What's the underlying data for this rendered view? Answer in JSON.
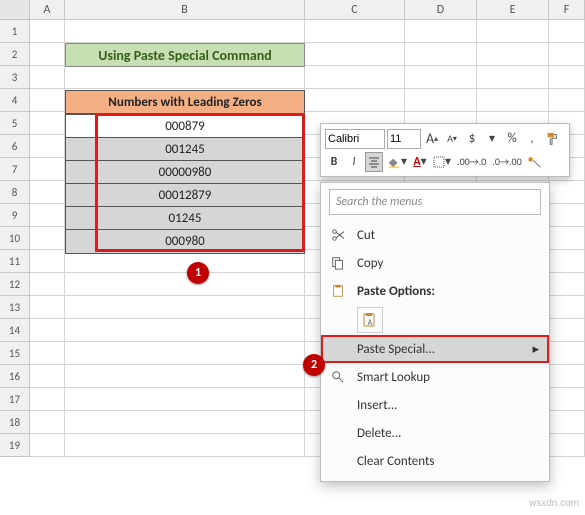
{
  "columns": [
    "A",
    "B",
    "C",
    "D",
    "E",
    "F"
  ],
  "row_numbers": [
    "1",
    "2",
    "3",
    "4",
    "5",
    "6",
    "7",
    "8",
    "9",
    "10",
    "11",
    "12",
    "13",
    "14",
    "15",
    "16",
    "17",
    "18",
    "19"
  ],
  "title": "Using Paste Special Command",
  "table": {
    "header": "Numbers with Leading Zeros",
    "rows": [
      "000879",
      "001245",
      "00000980",
      "00012879",
      "01245",
      "000980"
    ]
  },
  "callouts": {
    "one": "1",
    "two": "2"
  },
  "mini_toolbar": {
    "font_name": "Calibri",
    "font_size": "11",
    "grow": "A",
    "shrink": "A",
    "currency": "$",
    "percent": "%",
    "bold": "B",
    "italic": "I",
    "separator": ","
  },
  "context_menu": {
    "search_placeholder": "Search the menus",
    "cut": "Cut",
    "copy": "Copy",
    "paste_options": "Paste Options:",
    "paste_special": "Paste Special...",
    "smart_lookup": "Smart Lookup",
    "insert": "Insert...",
    "delete": "Delete...",
    "clear": "Clear Contents"
  },
  "watermark": "wsxdn.com"
}
